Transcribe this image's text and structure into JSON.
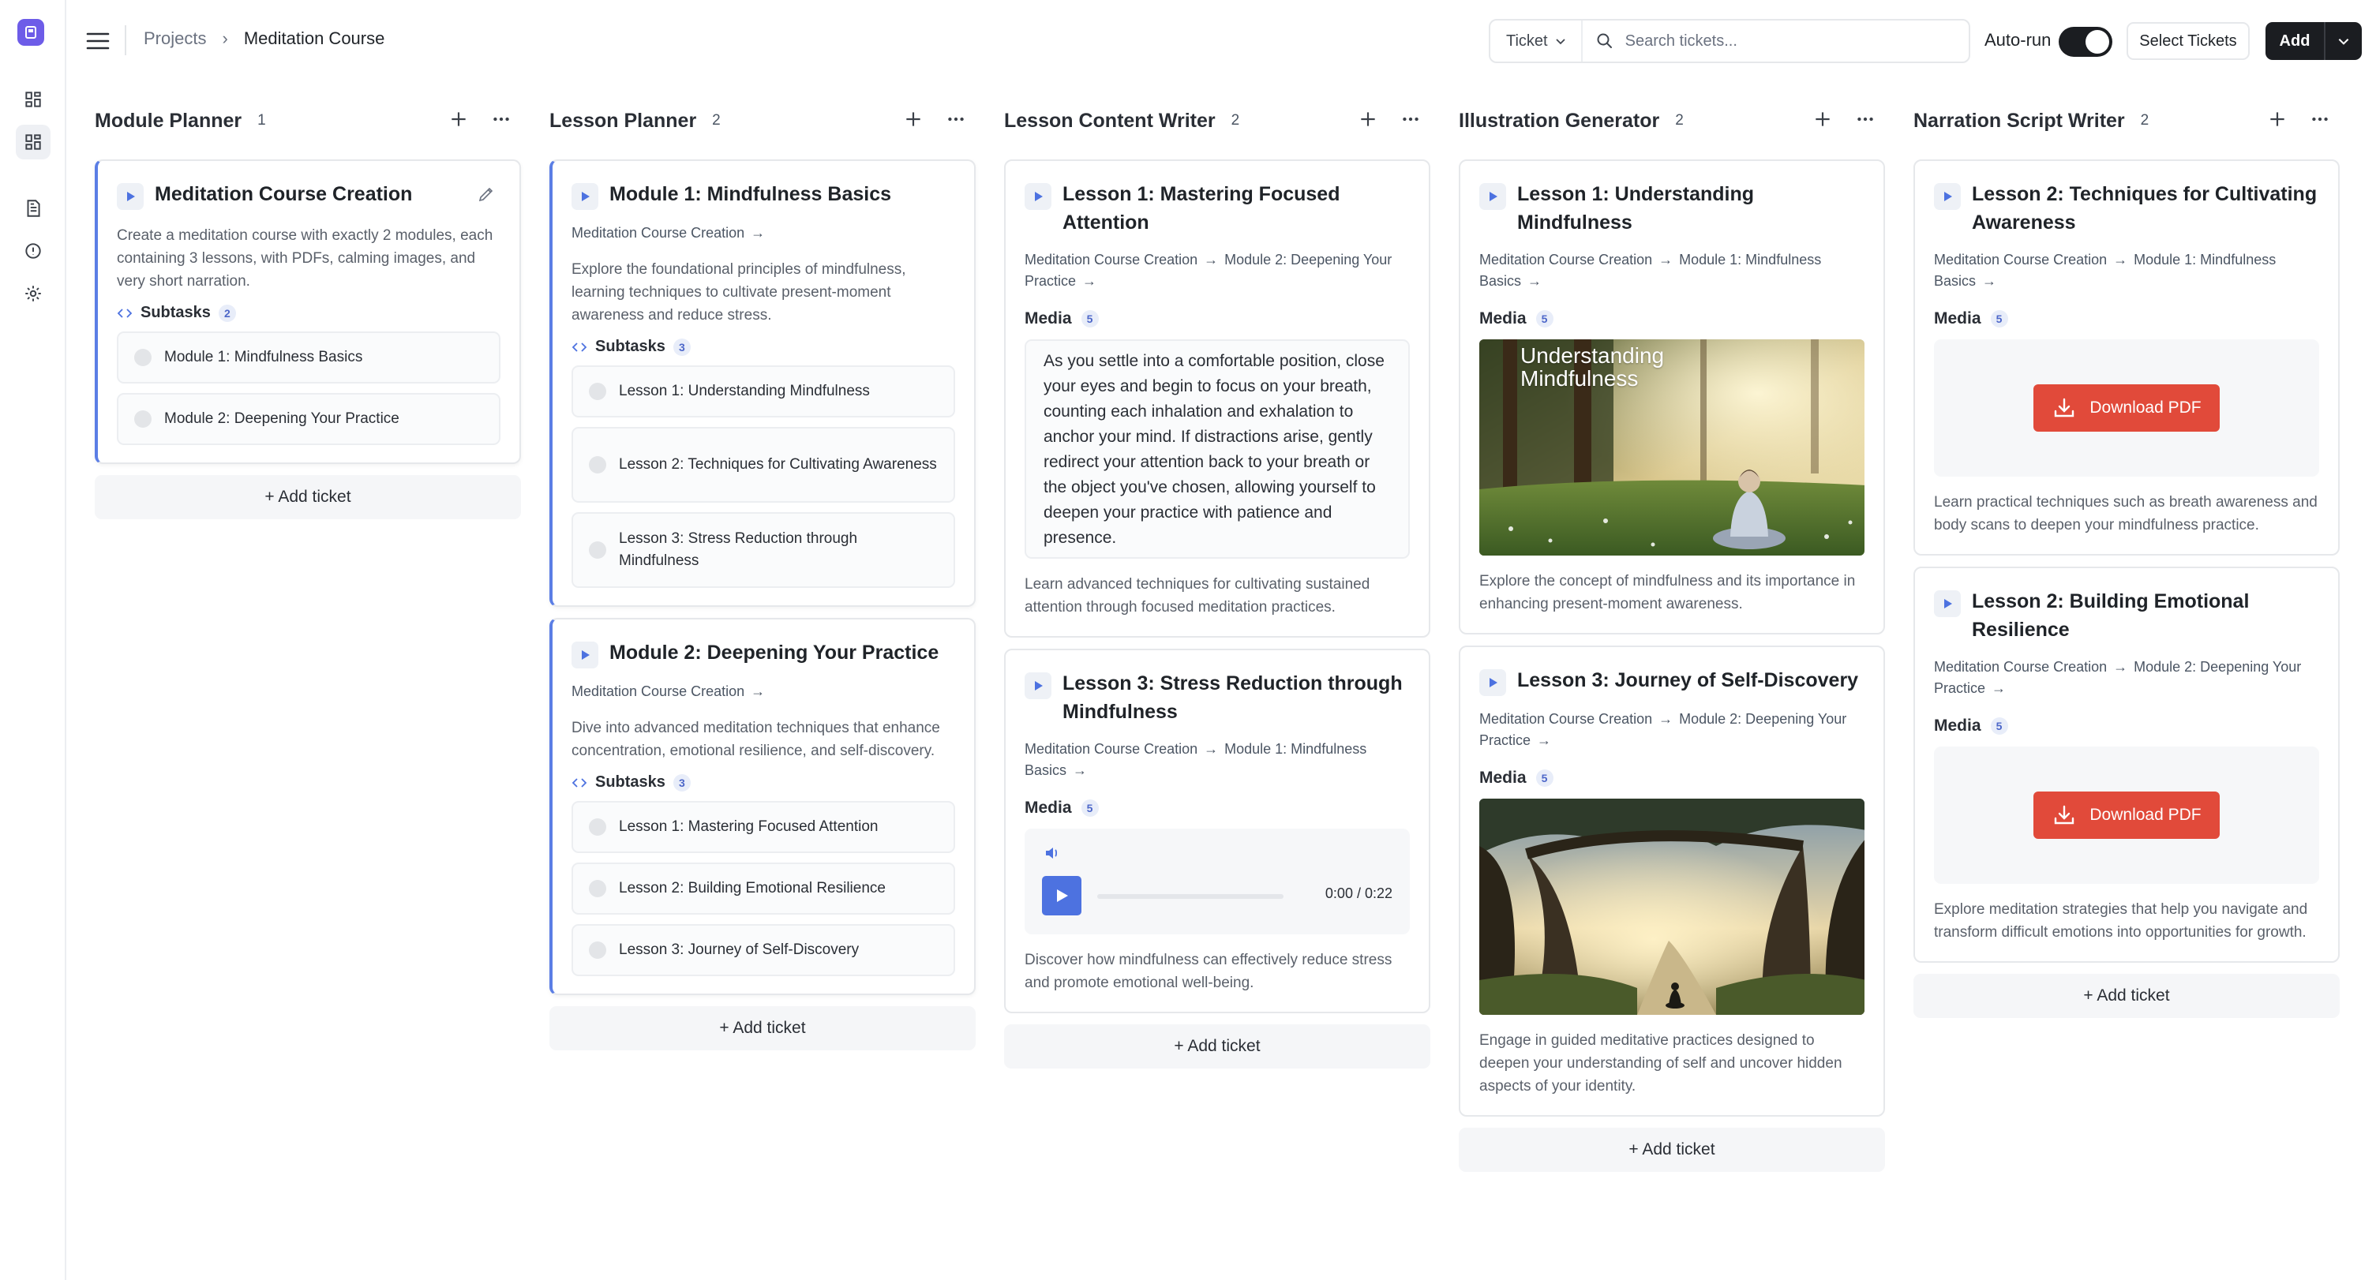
{
  "breadcrumb": {
    "root": "Projects",
    "current": "Meditation Course"
  },
  "toolbar": {
    "ticket_filter": "Ticket",
    "search_placeholder": "Search tickets...",
    "autorun_label": "Auto-run",
    "autorun_on": true,
    "select_tickets": "Select Tickets",
    "add_label": "Add"
  },
  "add_ticket_label": "+ Add ticket",
  "columns": [
    {
      "title": "Module Planner",
      "count": "1",
      "cards": [
        {
          "title": "Meditation Course Creation",
          "description": "Create a meditation course with exactly 2 modules, each containing 3 lessons, with PDFs, calming images, and very short narration.",
          "subtasks_label": "Subtasks",
          "subtasks_count": "2",
          "subtasks": [
            "Module 1: Mindfulness Basics",
            "Module 2: Deepening Your Practice"
          ]
        }
      ]
    },
    {
      "title": "Lesson Planner",
      "count": "2",
      "cards": [
        {
          "title": "Module 1: Mindfulness Basics",
          "path": "Meditation Course Creation",
          "description": "Explore the foundational principles of mindfulness, learning techniques to cultivate present-moment awareness and reduce stress.",
          "subtasks_label": "Subtasks",
          "subtasks_count": "3",
          "subtasks": [
            "Lesson 1: Understanding Mindfulness",
            "Lesson 2: Techniques for Cultivating Awareness",
            "Lesson 3: Stress Reduction through Mindfulness"
          ]
        },
        {
          "title": "Module 2: Deepening Your Practice",
          "path": "Meditation Course Creation",
          "description": "Dive into advanced meditation techniques that enhance concentration, emotional resilience, and self-discovery.",
          "subtasks_label": "Subtasks",
          "subtasks_count": "3",
          "subtasks": [
            "Lesson 1: Mastering Focused Attention",
            "Lesson 2: Building Emotional Resilience",
            "Lesson 3: Journey of Self-Discovery"
          ]
        }
      ]
    },
    {
      "title": "Lesson Content Writer",
      "count": "2",
      "cards": [
        {
          "title": "Lesson 1: Mastering Focused Attention",
          "path_1": "Meditation Course Creation",
          "path_2": "Module 2: Deepening Your Practice",
          "media_label": "Media",
          "media_count": "5",
          "text": "As you settle into a comfortable position, close your eyes and begin to focus on your breath, counting each inhalation and exhalation to anchor your mind. If distractions arise, gently redirect your attention back to your breath or the object you've chosen, allowing yourself to deepen your practice with patience and presence.",
          "description": "Learn advanced techniques for cultivating sustained attention through focused meditation practices."
        },
        {
          "title": "Lesson 3: Stress Reduction through Mindfulness",
          "path_1": "Meditation Course Creation",
          "path_2": "Module 1: Mindfulness Basics",
          "media_label": "Media",
          "media_count": "5",
          "audio_time": "0:00 / 0:22",
          "description": "Discover how mindfulness can effectively reduce stress and promote emotional well-being."
        }
      ]
    },
    {
      "title": "Illustration Generator",
      "count": "2",
      "cards": [
        {
          "title": "Lesson 1: Understanding Mindfulness",
          "path_1": "Meditation Course Creation",
          "path_2": "Module 1: Mindfulness Basics",
          "media_label": "Media",
          "media_count": "5",
          "image_caption": "Understanding Mindfulness",
          "description": "Explore the concept of mindfulness and its importance in enhancing present-moment awareness."
        },
        {
          "title": "Lesson 3: Journey of Self-Discovery",
          "path_1": "Meditation Course Creation",
          "path_2": "Module 2: Deepening Your Practice",
          "media_label": "Media",
          "media_count": "5",
          "description": "Engage in guided meditative practices designed to deepen your understanding of self and uncover hidden aspects of your identity."
        }
      ]
    },
    {
      "title": "Narration Script Writer",
      "count": "2",
      "cards": [
        {
          "title": "Lesson 2: Techniques for Cultivating Awareness",
          "path_1": "Meditation Course Creation",
          "path_2": "Module 1: Mindfulness Basics",
          "media_label": "Media",
          "media_count": "5",
          "pdf_label": "Download PDF",
          "description": "Learn practical techniques such as breath awareness and body scans to deepen your mindfulness practice."
        },
        {
          "title": "Lesson 2: Building Emotional Resilience",
          "path_1": "Meditation Course Creation",
          "path_2": "Module 2: Deepening Your Practice",
          "media_label": "Media",
          "media_count": "5",
          "pdf_label": "Download PDF",
          "description": "Explore meditation strategies that help you navigate and transform difficult emotions into opportunities for growth."
        }
      ]
    }
  ],
  "colors": {
    "accent": "#5b7ee5",
    "pdf_red": "#e14a3a",
    "dark": "#1b1d21"
  }
}
